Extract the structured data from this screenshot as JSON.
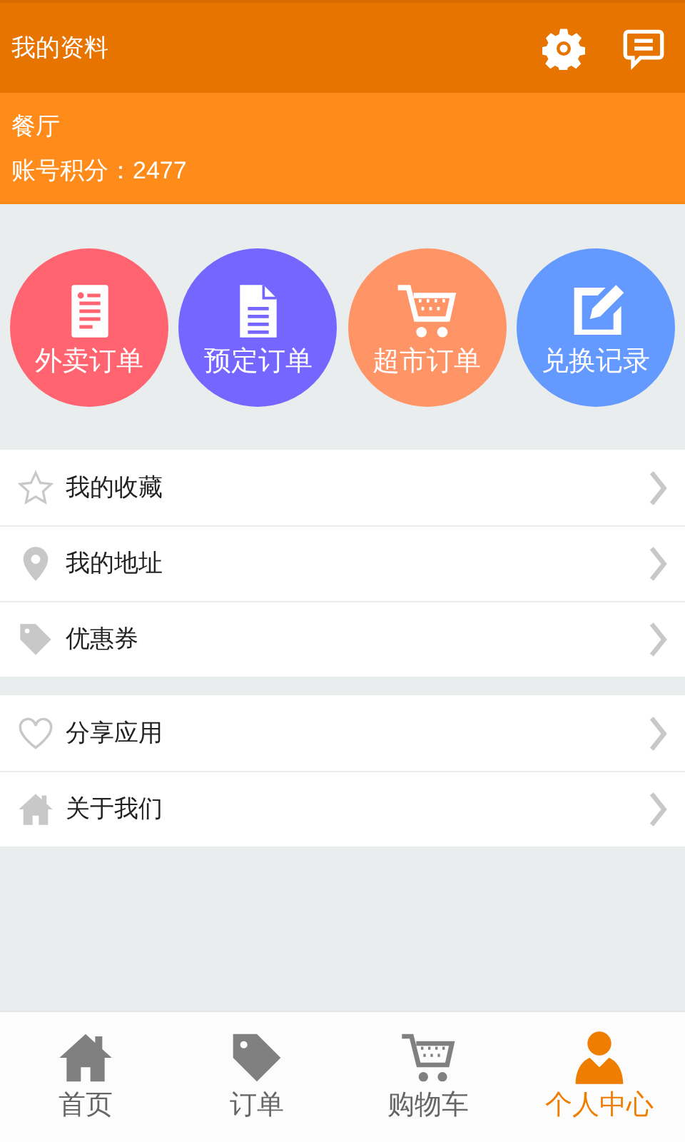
{
  "header": {
    "title": "我的资料"
  },
  "profile": {
    "name": "餐厅",
    "points": "账号积分：2477"
  },
  "shortcuts": [
    {
      "label": "外卖订单",
      "kind": "receipt",
      "color": "#ff6470"
    },
    {
      "label": "预定订单",
      "kind": "document",
      "color": "#7466ff"
    },
    {
      "label": "超市订单",
      "kind": "cart",
      "color": "#ff9466"
    },
    {
      "label": "兑换记录",
      "kind": "edit",
      "color": "#6499ff"
    }
  ],
  "menu_groups": [
    [
      {
        "label": "我的收藏",
        "kind": "star"
      },
      {
        "label": "我的地址",
        "kind": "pin"
      },
      {
        "label": "优惠券",
        "kind": "tag"
      }
    ],
    [
      {
        "label": "分享应用",
        "kind": "heart"
      },
      {
        "label": "关于我们",
        "kind": "home"
      }
    ]
  ],
  "tab_bar": [
    {
      "label": "首页",
      "kind": "home",
      "selected": false
    },
    {
      "label": "订单",
      "kind": "tag",
      "selected": false
    },
    {
      "label": "购物车",
      "kind": "cart",
      "selected": false
    },
    {
      "label": "个人中心",
      "kind": "person",
      "selected": true
    }
  ]
}
